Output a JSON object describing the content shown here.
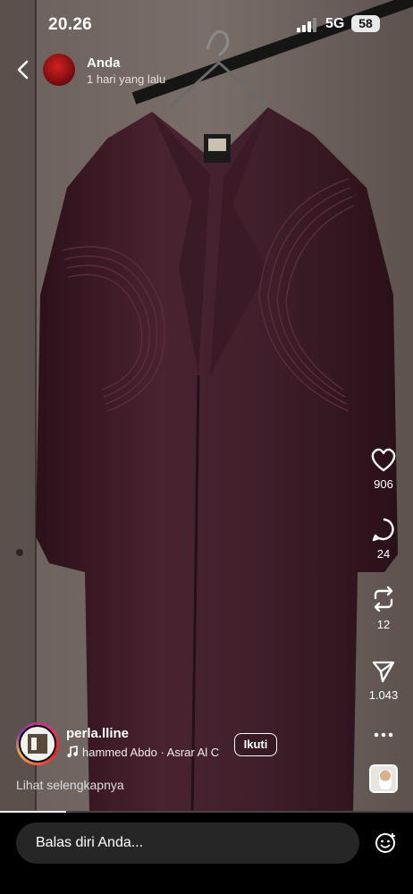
{
  "status_bar": {
    "time": "20.26",
    "network": "5G",
    "battery": "58"
  },
  "header": {
    "user_name": "Anda",
    "post_time": "1 hari yang lalu"
  },
  "actions": {
    "likes": "906",
    "comments": "24",
    "reposts": "12",
    "shares": "1.043"
  },
  "author": {
    "username": "perla.lline",
    "audio": "hammed Abdo · Asrar Al C",
    "follow_label": "Ikuti",
    "see_more": "Lihat selengkapnya"
  },
  "playback": {
    "progress_fraction": 0.16
  },
  "reply": {
    "placeholder": "Balas diri Anda..."
  },
  "icons": [
    "back-icon",
    "signal-icon",
    "heart-icon",
    "comment-icon",
    "repost-icon",
    "send-icon",
    "more-icon",
    "music-note-icon",
    "emoji-icon"
  ],
  "colors": {
    "garment": "#3f1e2a",
    "background": "#000000",
    "input_bg": "#262626"
  }
}
